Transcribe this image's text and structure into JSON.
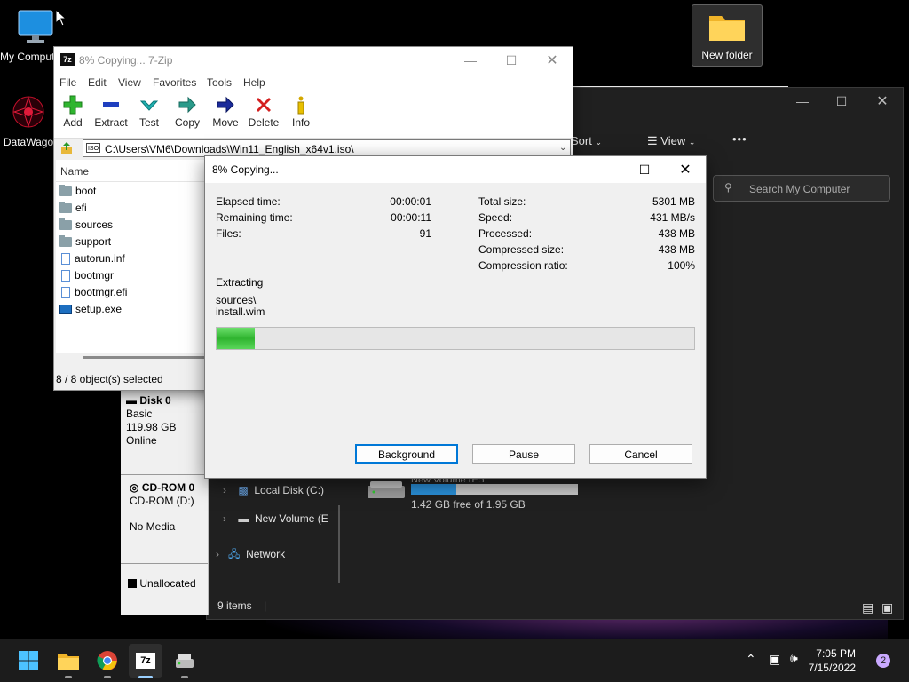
{
  "desktop": {
    "icons": [
      {
        "label": "My Computer"
      },
      {
        "label": "DataWago"
      },
      {
        "label": "New folder"
      }
    ]
  },
  "explorer": {
    "sort_label": "Sort",
    "view_label": "View",
    "more_label": "•••",
    "search_placeholder": "Search My Computer",
    "nav": [
      "Local Disk (C:)",
      "New Volume (E",
      "Network"
    ],
    "drive": {
      "name": "New Volume (E:)",
      "free_text": "1.42 GB free of 1.95 GB",
      "used_fraction": 0.27
    },
    "status": "9 items"
  },
  "diskmgmt": {
    "disk0": {
      "title": "Disk 0",
      "type": "Basic",
      "size": "119.98 GB",
      "state": "Online"
    },
    "cdrom0": {
      "title": "CD-ROM 0",
      "type": "CD-ROM (D:)",
      "state": "No Media"
    },
    "legend": "Unallocated"
  },
  "sevenzip": {
    "title": "8% Copying... 7-Zip",
    "app_badge": "7z",
    "menu": [
      "File",
      "Edit",
      "View",
      "Favorites",
      "Tools",
      "Help"
    ],
    "toolbar": [
      "Add",
      "Extract",
      "Test",
      "Copy",
      "Move",
      "Delete",
      "Info"
    ],
    "address": "C:\\Users\\VM6\\Downloads\\Win11_English_x64v1.iso\\",
    "address_badge": "ISO",
    "column_name": "Name",
    "files": [
      {
        "name": "boot",
        "type": "folder"
      },
      {
        "name": "efi",
        "type": "folder"
      },
      {
        "name": "sources",
        "type": "folder"
      },
      {
        "name": "support",
        "type": "folder"
      },
      {
        "name": "autorun.inf",
        "type": "file"
      },
      {
        "name": "bootmgr",
        "type": "file"
      },
      {
        "name": "bootmgr.efi",
        "type": "file"
      },
      {
        "name": "setup.exe",
        "type": "exe"
      }
    ],
    "status": "8 / 8 object(s) selected"
  },
  "progress_dialog": {
    "title": "8% Copying...",
    "elapsed_label": "Elapsed time:",
    "elapsed_value": "00:00:01",
    "remaining_label": "Remaining time:",
    "remaining_value": "00:00:11",
    "files_label": "Files:",
    "files_value": "91",
    "total_label": "Total size:",
    "total_value": "5301 MB",
    "speed_label": "Speed:",
    "speed_value": "431 MB/s",
    "processed_label": "Processed:",
    "processed_value": "438 MB",
    "compressed_label": "Compressed size:",
    "compressed_value": "438 MB",
    "ratio_label": "Compression ratio:",
    "ratio_value": "100%",
    "operation": "Extracting",
    "current_dir": "sources\\",
    "current_file": "install.wim",
    "progress_percent": 8,
    "buttons": {
      "background": "Background",
      "pause": "Pause",
      "cancel": "Cancel"
    }
  },
  "taskbar": {
    "time": "7:05 PM",
    "date": "7/15/2022",
    "notification_count": "2",
    "sevenzip_label": "7z"
  }
}
